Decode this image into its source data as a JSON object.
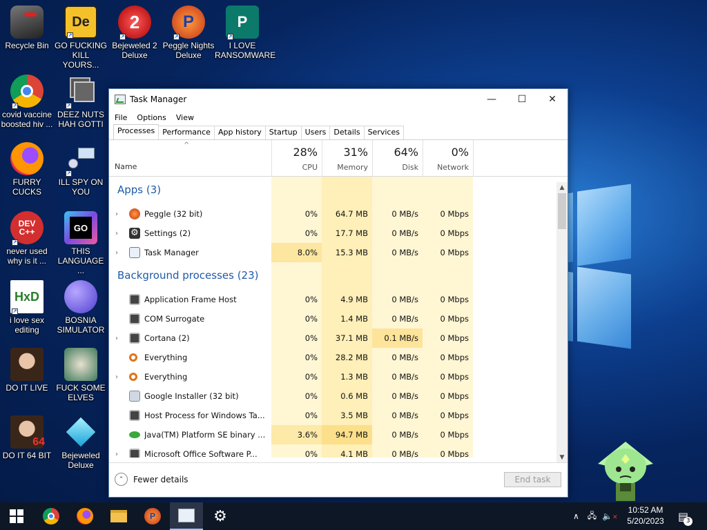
{
  "desktop": {
    "icons": [
      {
        "label": "Recycle Bin"
      },
      {
        "label": "GO FUCKING\nKILL YOURS..."
      },
      {
        "label": "Bejeweled 2\nDeluxe"
      },
      {
        "label": "Peggle Nights\nDeluxe"
      },
      {
        "label": "I LOVE\nRANSOMWARE"
      },
      {
        "label": "covid vaccine\nboosted hiv ..."
      },
      {
        "label": "DEEZ NUTS\nHAH GOTTI"
      },
      {
        "label": "FURRY CUCKS"
      },
      {
        "label": "ILL SPY ON\nYOU"
      },
      {
        "label": "never used\nwhy is it ..."
      },
      {
        "label": "THIS\nLANGUAGE ..."
      },
      {
        "label": "i love sex\nediting"
      },
      {
        "label": "BOSNIA\nSIMULATOR"
      },
      {
        "label": "DO IT LIVE"
      },
      {
        "label": "FUCK SOME\nELVES"
      },
      {
        "label": "DO IT 64 BIT"
      },
      {
        "label": "Bejeweled\nDeluxe"
      }
    ],
    "icon_text": {
      "de": "De",
      "devcpp": "DEV\nC++",
      "go": "GO",
      "hxd": "HxD",
      "sixtyfour": "64"
    }
  },
  "window": {
    "title": "Task Manager",
    "menu": [
      "File",
      "Options",
      "View"
    ],
    "tabs": [
      "Processes",
      "Performance",
      "App history",
      "Startup",
      "Users",
      "Details",
      "Services"
    ],
    "columns": {
      "name": "Name",
      "cpu": {
        "pct": "28%",
        "label": "CPU"
      },
      "memory": {
        "pct": "31%",
        "label": "Memory"
      },
      "disk": {
        "pct": "64%",
        "label": "Disk"
      },
      "network": {
        "pct": "0%",
        "label": "Network"
      }
    },
    "groups": {
      "apps": "Apps (3)",
      "background": "Background processes (23)"
    },
    "apps": [
      {
        "name": "Peggle (32 bit)",
        "cpu": "0%",
        "memory": "64.7 MB",
        "disk": "0 MB/s",
        "network": "0 Mbps"
      },
      {
        "name": "Settings (2)",
        "cpu": "0%",
        "memory": "17.7 MB",
        "disk": "0 MB/s",
        "network": "0 Mbps"
      },
      {
        "name": "Task Manager",
        "cpu": "8.0%",
        "memory": "15.3 MB",
        "disk": "0 MB/s",
        "network": "0 Mbps"
      }
    ],
    "background": [
      {
        "name": "Application Frame Host",
        "cpu": "0%",
        "memory": "4.9 MB",
        "disk": "0 MB/s",
        "network": "0 Mbps"
      },
      {
        "name": "COM Surrogate",
        "cpu": "0%",
        "memory": "1.4 MB",
        "disk": "0 MB/s",
        "network": "0 Mbps"
      },
      {
        "name": "Cortana (2)",
        "cpu": "0%",
        "memory": "37.1 MB",
        "disk": "0.1 MB/s",
        "network": "0 Mbps"
      },
      {
        "name": "Everything",
        "cpu": "0%",
        "memory": "28.2 MB",
        "disk": "0 MB/s",
        "network": "0 Mbps"
      },
      {
        "name": "Everything",
        "cpu": "0%",
        "memory": "1.3 MB",
        "disk": "0 MB/s",
        "network": "0 Mbps"
      },
      {
        "name": "Google Installer (32 bit)",
        "cpu": "0%",
        "memory": "0.6 MB",
        "disk": "0 MB/s",
        "network": "0 Mbps"
      },
      {
        "name": "Host Process for Windows Ta...",
        "cpu": "0%",
        "memory": "3.5 MB",
        "disk": "0 MB/s",
        "network": "0 Mbps"
      },
      {
        "name": "Java(TM) Platform SE binary ...",
        "cpu": "3.6%",
        "memory": "94.7 MB",
        "disk": "0 MB/s",
        "network": "0 Mbps"
      },
      {
        "name": "Microsoft Office Software P...",
        "cpu": "0%",
        "memory": "4.1 MB",
        "disk": "0 MB/s",
        "network": "0 Mbps"
      }
    ],
    "footer": {
      "fewer_details": "Fewer details",
      "end_task": "End task"
    }
  },
  "taskbar": {
    "clock_time": "10:52 AM",
    "clock_date": "5/20/2023",
    "notification_count": "3"
  },
  "colors": {
    "accent_blue": "#1e5aa8",
    "heat_light": "#fff4c4",
    "heat_medium": "#ffe9a0",
    "heat_strong": "#fcd97a",
    "taskbar": "#0e1726"
  }
}
